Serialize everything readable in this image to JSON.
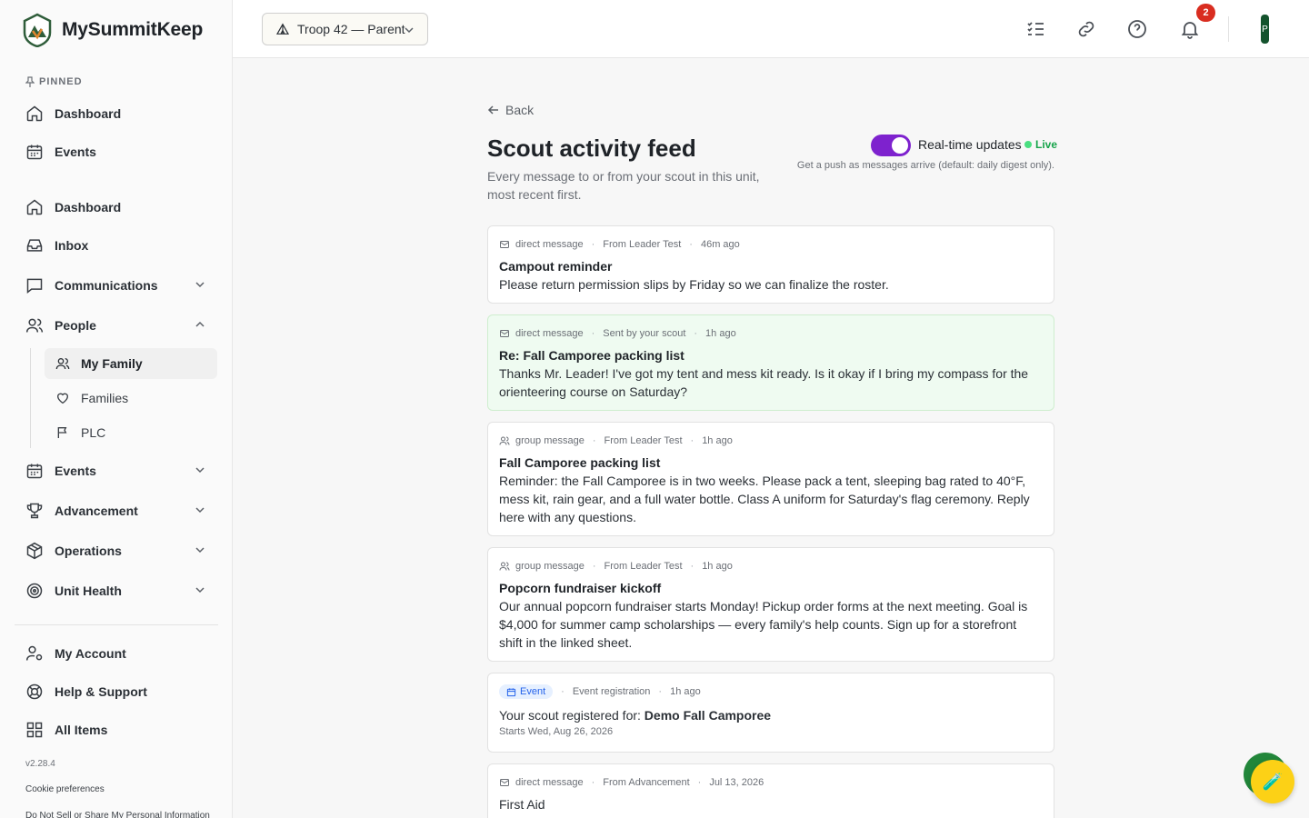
{
  "app": {
    "name": "MySummitKeep",
    "version": "v2.28.4"
  },
  "sidebar": {
    "pinned_label": "PINNED",
    "pinned": [
      {
        "label": "Dashboard",
        "icon": "home-icon"
      },
      {
        "label": "Events",
        "icon": "calendar-icon"
      }
    ],
    "items": [
      {
        "label": "Dashboard",
        "icon": "home-icon"
      },
      {
        "label": "Inbox",
        "icon": "inbox-icon"
      },
      {
        "label": "Communications",
        "icon": "message-icon",
        "expanded": false
      },
      {
        "label": "People",
        "icon": "users-icon",
        "expanded": true
      },
      {
        "label": "Events",
        "icon": "calendar-icon",
        "expanded": false
      },
      {
        "label": "Advancement",
        "icon": "trophy-icon",
        "expanded": false
      },
      {
        "label": "Operations",
        "icon": "box-icon",
        "expanded": false
      },
      {
        "label": "Unit Health",
        "icon": "target-icon",
        "expanded": false
      }
    ],
    "people_sub": [
      {
        "label": "My Family",
        "icon": "users-icon",
        "active": true
      },
      {
        "label": "Families",
        "icon": "heart-icon"
      },
      {
        "label": "PLC",
        "icon": "flag-icon"
      }
    ],
    "footer_items": [
      {
        "label": "My Account",
        "icon": "user-cog-icon"
      },
      {
        "label": "Help & Support",
        "icon": "lifebuoy-icon"
      },
      {
        "label": "All Items",
        "icon": "grid-icon"
      }
    ],
    "cookie_link": "Cookie preferences",
    "privacy_link": "Do Not Sell or Share My Personal Information"
  },
  "topbar": {
    "unit_selector": "Troop 42 — Parent",
    "notification_count": "2",
    "avatar_initial": "P"
  },
  "main": {
    "back_label": "Back",
    "title": "Scout activity feed",
    "subtitle": "Every message to or from your scout in this unit, most recent first.",
    "realtime": {
      "label": "Real-time updates",
      "enabled": true,
      "status": "Live",
      "hint": "Get a push as messages arrive (default: daily digest only)."
    },
    "feed": [
      {
        "type": "direct message",
        "source": "From Leader Test",
        "time": "46m ago",
        "title": "Campout reminder",
        "body": "Please return permission slips by Friday so we can finalize the roster."
      },
      {
        "type": "direct message",
        "source": "Sent by your scout",
        "time": "1h ago",
        "title": "Re: Fall Camporee packing list",
        "body": "Thanks Mr. Leader! I've got my tent and mess kit ready. Is it okay if I bring my compass for the orienteering course on Saturday?"
      },
      {
        "type": "group message",
        "source": "From Leader Test",
        "time": "1h ago",
        "title": "Fall Camporee packing list",
        "body": "Reminder: the Fall Camporee is in two weeks. Please pack a tent, sleeping bag rated to 40°F, mess kit, rain gear, and a full water bottle. Class A uniform for Saturday's flag ceremony. Reply here with any questions."
      },
      {
        "type": "group message",
        "source": "From Leader Test",
        "time": "1h ago",
        "title": "Popcorn fundraiser kickoff",
        "body": "Our annual popcorn fundraiser starts Monday! Pickup order forms at the next meeting. Goal is $4,000 for summer camp scholarships — every family's help counts. Sign up for a storefront shift in the linked sheet."
      }
    ],
    "event_item": {
      "pill": "Event",
      "category": "Event registration",
      "time": "1h ago",
      "prefix": "Your scout registered for:",
      "event_name": "Demo Fall Camporee",
      "starts": "Starts Wed, Aug 26, 2026"
    },
    "last_item": {
      "type": "direct message",
      "source": "From Advancement",
      "time": "Jul 13, 2026",
      "title": "First Aid"
    }
  },
  "colors": {
    "toggle": "#7e22ce",
    "live": "#16a34a",
    "badge": "#d92d20",
    "highlight_card": "#effbf1"
  }
}
